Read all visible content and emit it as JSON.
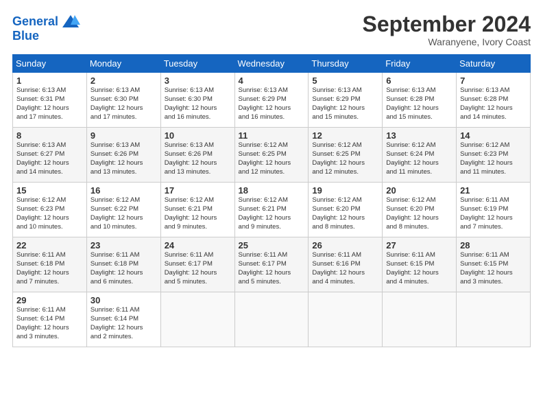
{
  "header": {
    "logo_line1": "General",
    "logo_line2": "Blue",
    "month": "September 2024",
    "location": "Waranyene, Ivory Coast"
  },
  "weekdays": [
    "Sunday",
    "Monday",
    "Tuesday",
    "Wednesday",
    "Thursday",
    "Friday",
    "Saturday"
  ],
  "weeks": [
    [
      {
        "day": "1",
        "sunrise": "6:13 AM",
        "sunset": "6:31 PM",
        "daylight": "12 hours and 17 minutes."
      },
      {
        "day": "2",
        "sunrise": "6:13 AM",
        "sunset": "6:30 PM",
        "daylight": "12 hours and 17 minutes."
      },
      {
        "day": "3",
        "sunrise": "6:13 AM",
        "sunset": "6:30 PM",
        "daylight": "12 hours and 16 minutes."
      },
      {
        "day": "4",
        "sunrise": "6:13 AM",
        "sunset": "6:29 PM",
        "daylight": "12 hours and 16 minutes."
      },
      {
        "day": "5",
        "sunrise": "6:13 AM",
        "sunset": "6:29 PM",
        "daylight": "12 hours and 15 minutes."
      },
      {
        "day": "6",
        "sunrise": "6:13 AM",
        "sunset": "6:28 PM",
        "daylight": "12 hours and 15 minutes."
      },
      {
        "day": "7",
        "sunrise": "6:13 AM",
        "sunset": "6:28 PM",
        "daylight": "12 hours and 14 minutes."
      }
    ],
    [
      {
        "day": "8",
        "sunrise": "6:13 AM",
        "sunset": "6:27 PM",
        "daylight": "12 hours and 14 minutes."
      },
      {
        "day": "9",
        "sunrise": "6:13 AM",
        "sunset": "6:26 PM",
        "daylight": "12 hours and 13 minutes."
      },
      {
        "day": "10",
        "sunrise": "6:13 AM",
        "sunset": "6:26 PM",
        "daylight": "12 hours and 13 minutes."
      },
      {
        "day": "11",
        "sunrise": "6:12 AM",
        "sunset": "6:25 PM",
        "daylight": "12 hours and 12 minutes."
      },
      {
        "day": "12",
        "sunrise": "6:12 AM",
        "sunset": "6:25 PM",
        "daylight": "12 hours and 12 minutes."
      },
      {
        "day": "13",
        "sunrise": "6:12 AM",
        "sunset": "6:24 PM",
        "daylight": "12 hours and 11 minutes."
      },
      {
        "day": "14",
        "sunrise": "6:12 AM",
        "sunset": "6:23 PM",
        "daylight": "12 hours and 11 minutes."
      }
    ],
    [
      {
        "day": "15",
        "sunrise": "6:12 AM",
        "sunset": "6:23 PM",
        "daylight": "12 hours and 10 minutes."
      },
      {
        "day": "16",
        "sunrise": "6:12 AM",
        "sunset": "6:22 PM",
        "daylight": "12 hours and 10 minutes."
      },
      {
        "day": "17",
        "sunrise": "6:12 AM",
        "sunset": "6:21 PM",
        "daylight": "12 hours and 9 minutes."
      },
      {
        "day": "18",
        "sunrise": "6:12 AM",
        "sunset": "6:21 PM",
        "daylight": "12 hours and 9 minutes."
      },
      {
        "day": "19",
        "sunrise": "6:12 AM",
        "sunset": "6:20 PM",
        "daylight": "12 hours and 8 minutes."
      },
      {
        "day": "20",
        "sunrise": "6:12 AM",
        "sunset": "6:20 PM",
        "daylight": "12 hours and 8 minutes."
      },
      {
        "day": "21",
        "sunrise": "6:11 AM",
        "sunset": "6:19 PM",
        "daylight": "12 hours and 7 minutes."
      }
    ],
    [
      {
        "day": "22",
        "sunrise": "6:11 AM",
        "sunset": "6:18 PM",
        "daylight": "12 hours and 7 minutes."
      },
      {
        "day": "23",
        "sunrise": "6:11 AM",
        "sunset": "6:18 PM",
        "daylight": "12 hours and 6 minutes."
      },
      {
        "day": "24",
        "sunrise": "6:11 AM",
        "sunset": "6:17 PM",
        "daylight": "12 hours and 5 minutes."
      },
      {
        "day": "25",
        "sunrise": "6:11 AM",
        "sunset": "6:17 PM",
        "daylight": "12 hours and 5 minutes."
      },
      {
        "day": "26",
        "sunrise": "6:11 AM",
        "sunset": "6:16 PM",
        "daylight": "12 hours and 4 minutes."
      },
      {
        "day": "27",
        "sunrise": "6:11 AM",
        "sunset": "6:15 PM",
        "daylight": "12 hours and 4 minutes."
      },
      {
        "day": "28",
        "sunrise": "6:11 AM",
        "sunset": "6:15 PM",
        "daylight": "12 hours and 3 minutes."
      }
    ],
    [
      {
        "day": "29",
        "sunrise": "6:11 AM",
        "sunset": "6:14 PM",
        "daylight": "12 hours and 3 minutes."
      },
      {
        "day": "30",
        "sunrise": "6:11 AM",
        "sunset": "6:14 PM",
        "daylight": "12 hours and 2 minutes."
      },
      null,
      null,
      null,
      null,
      null
    ]
  ]
}
